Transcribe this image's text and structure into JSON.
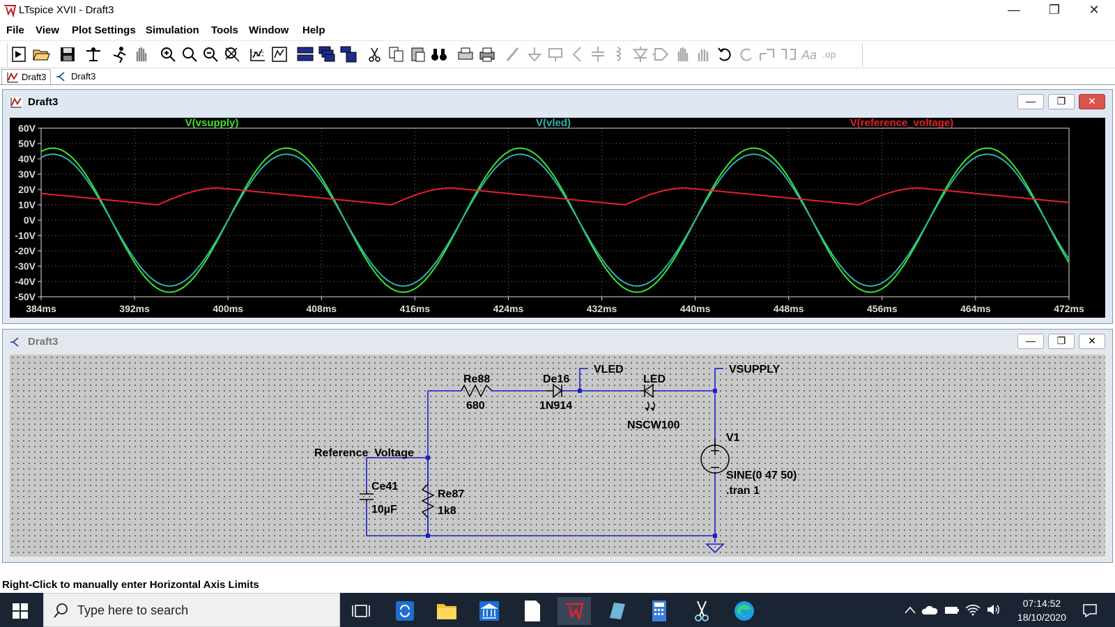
{
  "window": {
    "title": "LTspice XVII - Draft3",
    "minimize": "—",
    "maximize": "❐",
    "close": "✕"
  },
  "menu": [
    "File",
    "View",
    "Plot Settings",
    "Simulation",
    "Tools",
    "Window",
    "Help"
  ],
  "tabs": [
    {
      "label": "Draft3",
      "icon": "waveform-icon"
    },
    {
      "label": "Draft3",
      "icon": "schematic-icon"
    }
  ],
  "plot_window": {
    "title": "Draft3"
  },
  "schematic_window": {
    "title": "Draft3"
  },
  "chart_data": {
    "type": "line",
    "xlim": [
      384,
      472
    ],
    "ylim": [
      -50,
      60
    ],
    "x_ticks": [
      "384ms",
      "392ms",
      "400ms",
      "408ms",
      "416ms",
      "424ms",
      "432ms",
      "440ms",
      "448ms",
      "456ms",
      "464ms",
      "472ms"
    ],
    "y_ticks": [
      "60V",
      "50V",
      "40V",
      "30V",
      "20V",
      "10V",
      "0V",
      "-10V",
      "-20V",
      "-30V",
      "-40V",
      "-50V"
    ],
    "grid": true,
    "background": "#000000",
    "series": [
      {
        "name": "V(vsupply)",
        "color": "#39e62c",
        "model": "sine",
        "amplitude": 47,
        "frequency_hz": 50,
        "offset": 0
      },
      {
        "name": "V(vled)",
        "color": "#2cb3b0",
        "model": "sine",
        "amplitude": 43,
        "frequency_hz": 50,
        "offset": 0
      },
      {
        "name": "V(reference_voltage)",
        "color": "#e8202a",
        "model": "ripple",
        "peak": 21,
        "valley": 10,
        "frequency_hz": 50
      }
    ]
  },
  "schematic": {
    "components": {
      "re88": {
        "name": "Re88",
        "value": "680"
      },
      "de16": {
        "name": "De16",
        "value": "1N914"
      },
      "led": {
        "name": "LED",
        "value": "NSCW100"
      },
      "v1": {
        "name": "V1",
        "value": "SINE(0 47 50)",
        "directive": ".tran 1"
      },
      "ce41": {
        "name": "Ce41",
        "value": "10µF"
      },
      "re87": {
        "name": "Re87",
        "value": "1k8"
      }
    },
    "nets": {
      "vled": "VLED",
      "vsupply": "VSUPPLY",
      "reference": "Reference_Voltage"
    },
    "wire_color": "#1a20c8"
  },
  "status": {
    "text": "Right-Click to manually enter Horizontal Axis Limits"
  },
  "taskbar": {
    "search_placeholder": "Type here to search",
    "time": "07:14:52",
    "date": "18/10/2020"
  }
}
